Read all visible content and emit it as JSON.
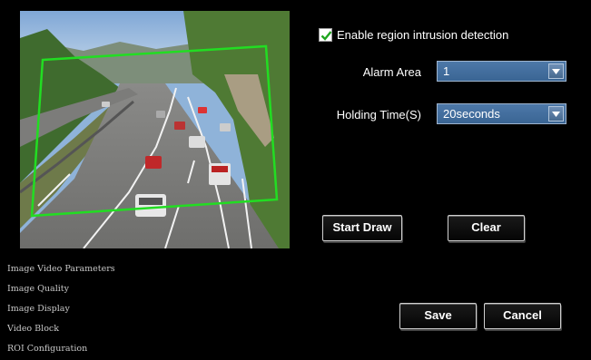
{
  "settings": {
    "enable_label": "Enable region intrusion detection",
    "enabled": true,
    "alarm_area_label": "Alarm Area",
    "alarm_area_value": "1",
    "holding_time_label": "Holding Time(S)",
    "holding_time_value": "20seconds"
  },
  "buttons": {
    "start_draw": "Start Draw",
    "clear": "Clear",
    "save": "Save",
    "cancel": "Cancel"
  },
  "nav": [
    "Image Video Parameters",
    "Image Quality",
    "Image Display",
    "Video Block",
    "ROI Configuration"
  ],
  "colors": {
    "region_outline": "#22dd22",
    "accent": "#3d6a9a"
  }
}
